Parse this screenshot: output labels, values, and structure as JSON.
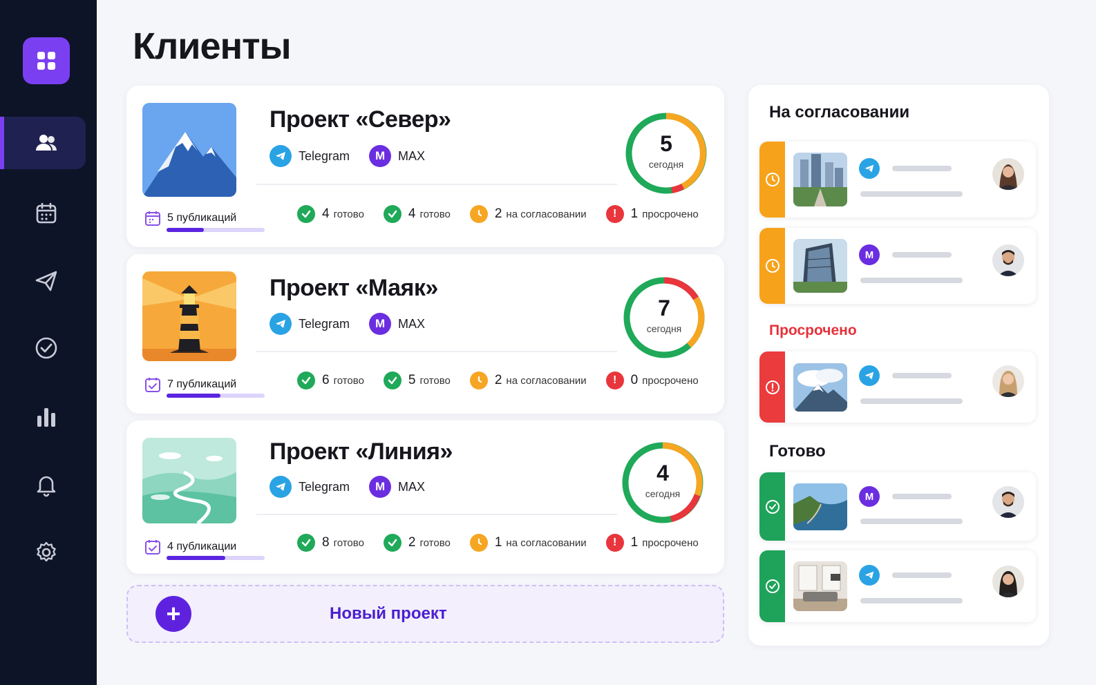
{
  "page": {
    "title": "Клиенты"
  },
  "sidebar": {
    "logo_icon": "grid-icon",
    "items": [
      {
        "icon": "users-icon",
        "active": true
      },
      {
        "icon": "calendar-icon",
        "active": false
      },
      {
        "icon": "send-icon",
        "active": false
      },
      {
        "icon": "check-circle-icon",
        "active": false
      },
      {
        "icon": "bar-chart-icon",
        "active": false
      },
      {
        "icon": "bell-icon",
        "active": false
      },
      {
        "icon": "settings-icon",
        "active": false
      }
    ]
  },
  "projects": [
    {
      "name": "Проект «Север»",
      "channels": [
        "Telegram",
        "MAX"
      ],
      "publications": "5 публикаций",
      "progress": 0.38,
      "today_count": "5",
      "today_label": "сегодня",
      "stats": [
        {
          "count": "4",
          "label": "готово"
        },
        {
          "count": "4",
          "label": "готово"
        },
        {
          "count": "2",
          "label": "на согласовании"
        },
        {
          "count": "1",
          "label": "просрочено"
        }
      ]
    },
    {
      "name": "Проект «Маяк»",
      "channels": [
        "Telegram",
        "MAX"
      ],
      "publications": "7 публикаций",
      "progress": 0.55,
      "today_count": "7",
      "today_label": "сегодня",
      "stats": [
        {
          "count": "6",
          "label": "готово"
        },
        {
          "count": "5",
          "label": "готово"
        },
        {
          "count": "2",
          "label": "на согласовании"
        },
        {
          "count": "0",
          "label": "просрочено"
        }
      ]
    },
    {
      "name": "Проект «Линия»",
      "channels": [
        "Telegram",
        "MAX"
      ],
      "publications": "4 публикации",
      "progress": 0.6,
      "today_count": "4",
      "today_label": "сегодня",
      "stats": [
        {
          "count": "8",
          "label": "готово"
        },
        {
          "count": "2",
          "label": "готово"
        },
        {
          "count": "1",
          "label": "на согласовании"
        },
        {
          "count": "1",
          "label": "просрочено"
        }
      ]
    }
  ],
  "new_project": {
    "label": "Новый проект"
  },
  "review": {
    "pending_title": "На согласовании",
    "overdue_title": "Просрочено",
    "done_title": "Готово"
  },
  "colors": {
    "accent": "#7b3ff2",
    "sidebar": "#0e1428",
    "ready": "#1fa959",
    "pending": "#f6a623",
    "overdue": "#e9353c",
    "telegram": "#2aa3e4",
    "max": "#6a2ee0"
  }
}
